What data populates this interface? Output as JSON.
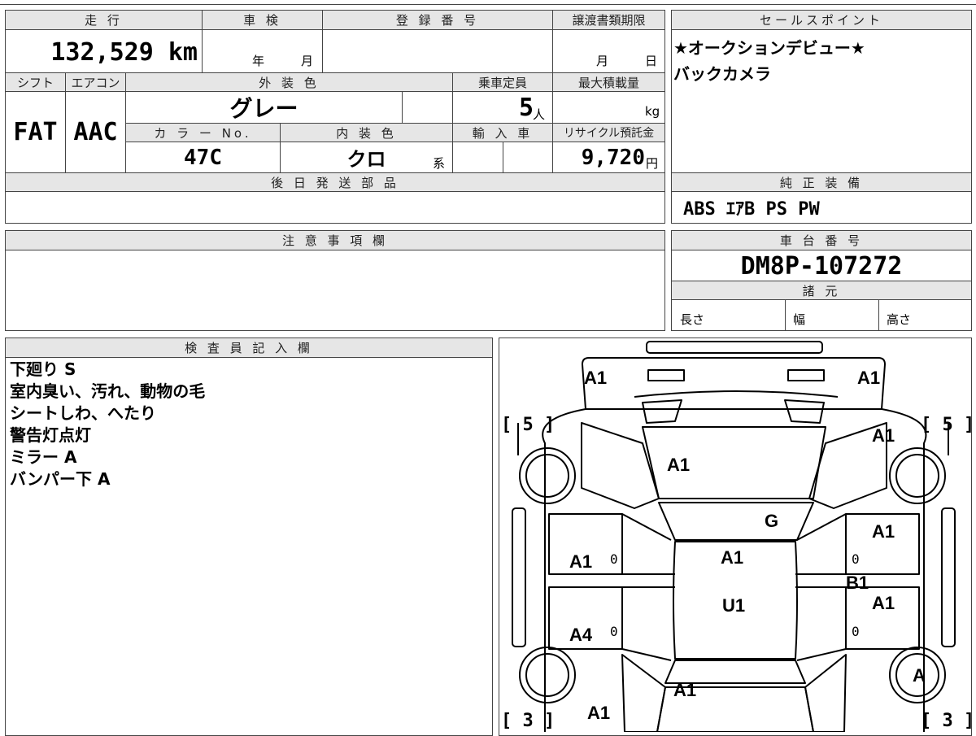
{
  "top_sheet": {
    "headers": {
      "mileage": "走 行",
      "inspection": "車 検",
      "registration": "登 録 番 号",
      "transfer_deadline": "譲渡書類期限",
      "shift": "シフト",
      "aircon": "エアコン",
      "exterior_color": "外 装 色",
      "capacity": "乗車定員",
      "max_load": "最大積載量",
      "color_no": "カ ラ ー No.",
      "interior_color": "内 装 色",
      "import": "輸 入 車",
      "recycle": "リサイクル預託金"
    },
    "values": {
      "mileage": "132,529 km",
      "inspection_year_unit": "年",
      "inspection_month_unit": "月",
      "deadline_month_unit": "月",
      "deadline_day_unit": "日",
      "shift": "FAT",
      "aircon": "AAC",
      "exterior_color": "グレー",
      "capacity": "5",
      "capacity_unit": "人",
      "max_load_unit": "kg",
      "color_no": "47C",
      "interior_color": "クロ",
      "interior_suffix": "系",
      "recycle": "9,720",
      "recycle_unit": "円"
    },
    "later_parts_header": "後 日 発 送 部 品"
  },
  "sales_points": {
    "header": "セールスポイント",
    "lines": [
      "★オークションデビュー★",
      "バックカメラ"
    ]
  },
  "genuine_equipment": {
    "header": "純 正 装 備",
    "value": "ABS ｴｱB PS PW"
  },
  "caution": {
    "header": "注 意 事 項 欄"
  },
  "chassis": {
    "header": "車 台 番 号",
    "value": "DM8P-107272"
  },
  "specs": {
    "header": "諸 元",
    "length": "長さ",
    "width": "幅",
    "height": "高さ"
  },
  "inspector": {
    "header": "検 査 員 記 入 欄",
    "lines": [
      "下廻り S",
      "室内臭い、汚れ、動物の毛",
      "シートしわ、へたり",
      "警告灯点灯",
      "ミラー A",
      "バンパー下 A"
    ]
  },
  "diagram": {
    "brackets": {
      "top_left": "[ 5 ]",
      "top_right": "[ 5 ]",
      "bottom_left": "[ 3 ]",
      "bottom_right": "[ 3 ]"
    },
    "labels": {
      "front_bumper_left": "A1",
      "front_bumper_right": "A1",
      "left_front_fender": "A1",
      "hood": "A1",
      "windshield": "G",
      "right_front_fender": "A1",
      "left_front_door": "A1",
      "roof": "A1",
      "right_front_door": "B1",
      "roof_rear": "U1",
      "right_rear_door": "A1",
      "left_rear_door": "A4",
      "right_rear_wheel": "A",
      "tailgate": "A1",
      "left_rear_fender": "A1"
    },
    "small_marks": [
      "0",
      "0",
      "0",
      "0"
    ]
  }
}
